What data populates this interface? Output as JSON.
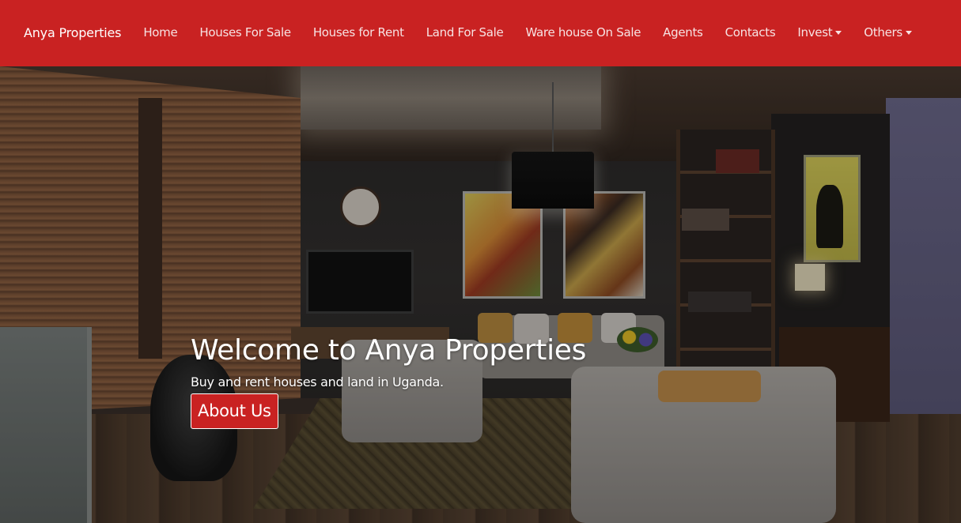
{
  "navbar": {
    "brand": "Anya Properties",
    "links": [
      {
        "label": "Home"
      },
      {
        "label": "Houses For Sale"
      },
      {
        "label": "Houses for Rent"
      },
      {
        "label": "Land For Sale"
      },
      {
        "label": "Ware house On Sale"
      },
      {
        "label": "Agents"
      },
      {
        "label": "Contacts"
      },
      {
        "label": "Invest",
        "icon": "caret-down-icon"
      },
      {
        "label": "Others",
        "icon": "caret-down-icon"
      }
    ],
    "background_color": "#c92222"
  },
  "hero": {
    "title": "Welcome to Anya Properties",
    "subtitle": "Buy and rent houses and land in Uganda.",
    "button_label": "About Us",
    "button_color": "#c92222"
  }
}
